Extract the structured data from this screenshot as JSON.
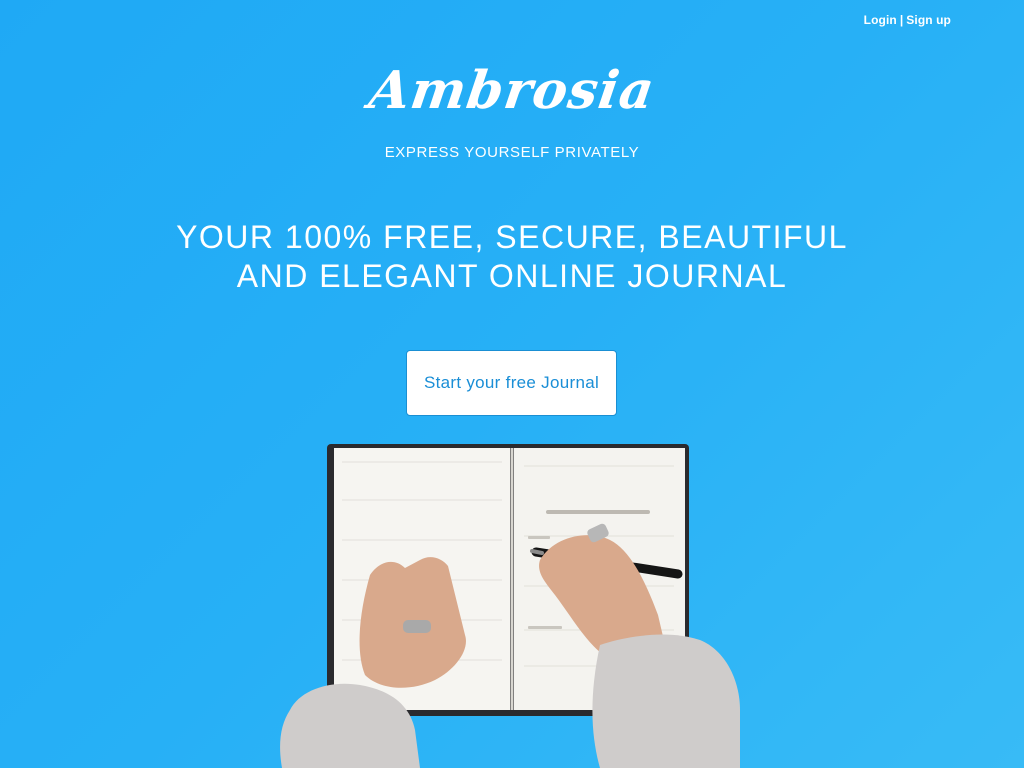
{
  "nav": {
    "login": "Login",
    "separator": "|",
    "signup": "Sign up"
  },
  "brand": {
    "name": "Ambrosia",
    "tagline": "EXPRESS YOURSELF PRIVATELY"
  },
  "hero": {
    "headline_line1": "YOUR 100% FREE, SECURE, BEAUTIFUL",
    "headline_line2": "AND ELEGANT ONLINE JOURNAL",
    "cta_label": "Start your free Journal"
  },
  "colors": {
    "background": "#27b0f6",
    "accent": "#1a8ed6",
    "text": "#ffffff"
  },
  "illustration": {
    "icon": "journal-writing-hands-illustration"
  }
}
